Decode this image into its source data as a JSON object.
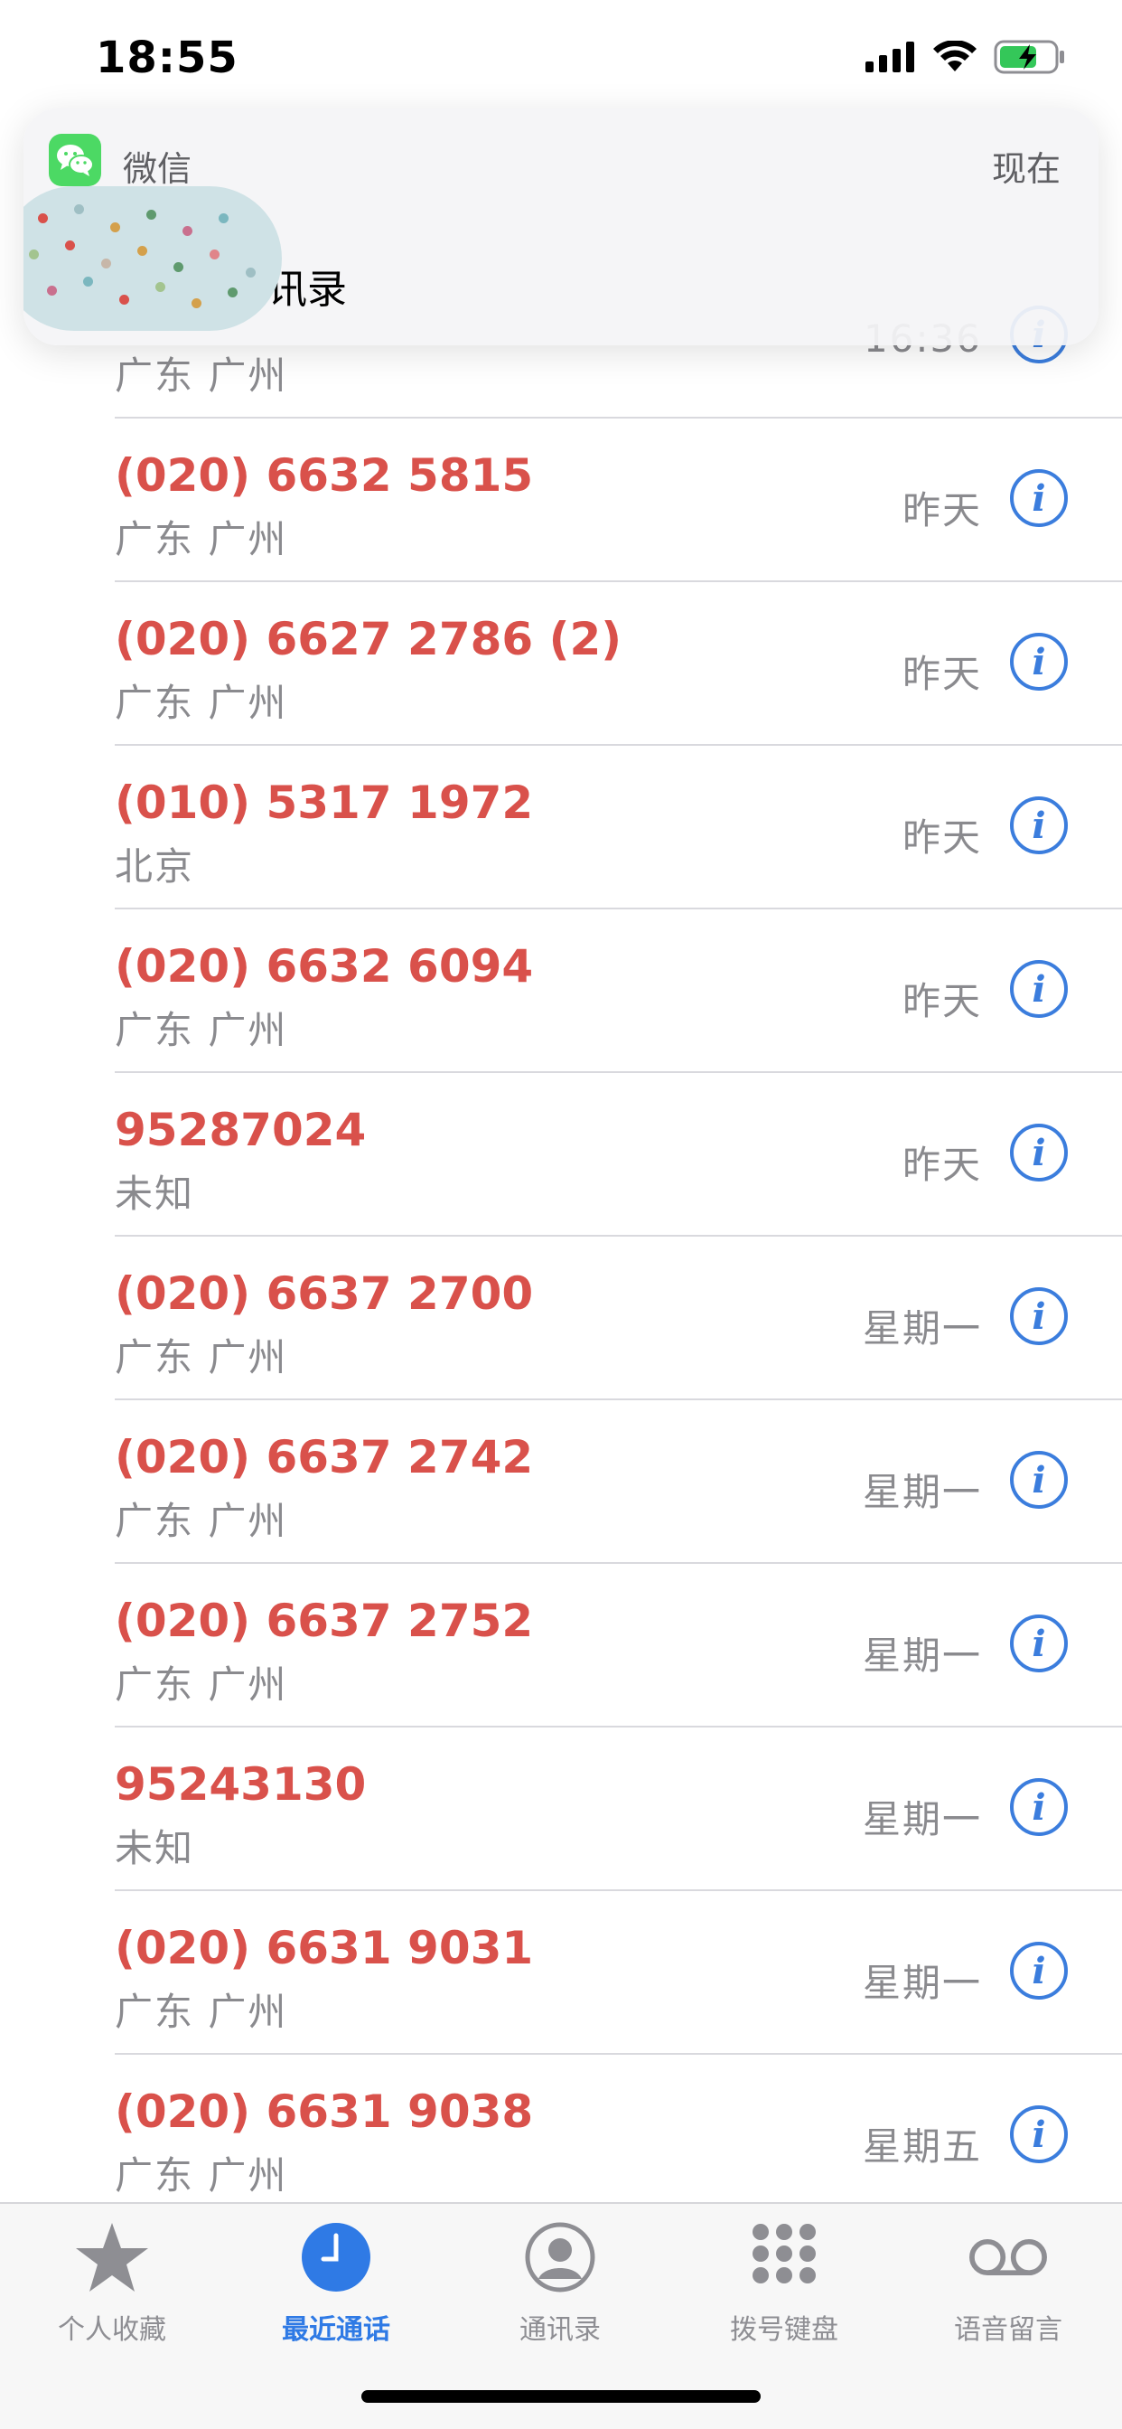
{
  "status_bar": {
    "time": "18:55"
  },
  "notification": {
    "app_name": "微信",
    "time": "现在",
    "body_visible": "讯录"
  },
  "partial_row": {
    "location": "广东 广州",
    "time_fragment": "16:36"
  },
  "calls": [
    {
      "number": "(020) 6632 5815",
      "location": "广东 广州",
      "time": "昨天"
    },
    {
      "number": "(020) 6627 2786 (2)",
      "location": "广东 广州",
      "time": "昨天"
    },
    {
      "number": "(010) 5317 1972",
      "location": "北京",
      "time": "昨天"
    },
    {
      "number": "(020) 6632 6094",
      "location": "广东 广州",
      "time": "昨天"
    },
    {
      "number": "95287024",
      "location": "未知",
      "time": "昨天"
    },
    {
      "number": "(020) 6637 2700",
      "location": "广东 广州",
      "time": "星期一"
    },
    {
      "number": "(020) 6637 2742",
      "location": "广东 广州",
      "time": "星期一"
    },
    {
      "number": "(020) 6637 2752",
      "location": "广东 广州",
      "time": "星期一"
    },
    {
      "number": "95243130",
      "location": "未知",
      "time": "星期一"
    },
    {
      "number": "(020) 6631 9031",
      "location": "广东 广州",
      "time": "星期一"
    },
    {
      "number": "(020) 6631 9038",
      "location": "广东 广州",
      "time": "星期五"
    }
  ],
  "info_glyph": "i",
  "tabs": [
    {
      "label": "个人收藏",
      "icon": "star-icon",
      "active": false
    },
    {
      "label": "最近通话",
      "icon": "clock-icon",
      "active": true
    },
    {
      "label": "通讯录",
      "icon": "contact-icon",
      "active": false
    },
    {
      "label": "拨号键盘",
      "icon": "keypad-icon",
      "active": false
    },
    {
      "label": "语音留言",
      "icon": "voicemail-icon",
      "active": false
    }
  ],
  "colors": {
    "missed_call": "#d9514b",
    "accent": "#2f7ae5",
    "secondary_text": "#8a8a8e",
    "wechat_green": "#4cd964"
  }
}
